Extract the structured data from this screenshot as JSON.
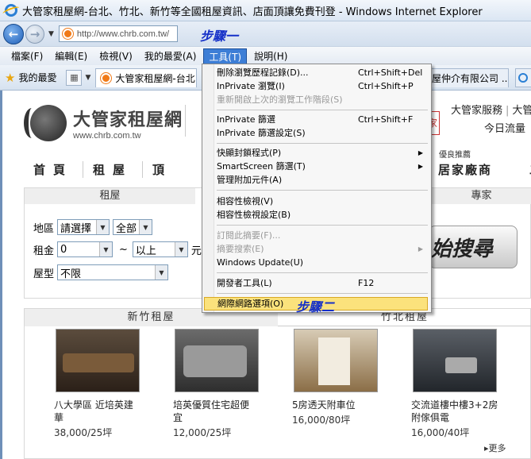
{
  "window": {
    "title": "大管家租屋網-台北、竹北、新竹等全國租屋資訊、店面頂讓免費刊登 - Windows Internet Explorer"
  },
  "address": {
    "url": "http://www.chrb.com.tw/",
    "step1": "步驟一"
  },
  "menubar": {
    "items": [
      "檔案(F)",
      "編輯(E)",
      "檢視(V)",
      "我的最愛(A)",
      "工具(T)",
      "說明(H)"
    ]
  },
  "favbar": {
    "favorites_label": "我的最愛",
    "tab_title": "大管家租屋網-台北...",
    "tab2_title": "屋仲介有限公司 ..."
  },
  "tools_menu": {
    "step2": "步驟二",
    "items": [
      {
        "label": "刪除瀏覽歷程記錄(D)...",
        "shortcut": "Ctrl+Shift+Del"
      },
      {
        "label": "InPrivate 瀏覽(I)",
        "shortcut": "Ctrl+Shift+P"
      },
      {
        "label": "重新開啟上次的瀏覽工作階段(S)",
        "shortcut": ""
      },
      {
        "label": "InPrivate 篩選",
        "shortcut": "Ctrl+Shift+F"
      },
      {
        "label": "InPrivate 篩選設定(S)",
        "shortcut": ""
      },
      {
        "label": "快顯封鎖程式(P)",
        "shortcut": ""
      },
      {
        "label": "SmartScreen 篩選(T)",
        "shortcut": ""
      },
      {
        "label": "管理附加元件(A)",
        "shortcut": ""
      },
      {
        "label": "相容性檢視(V)",
        "shortcut": ""
      },
      {
        "label": "相容性檢視設定(B)",
        "shortcut": ""
      },
      {
        "label": "訂閱此摘要(F)...",
        "shortcut": ""
      },
      {
        "label": "摘要搜索(E)",
        "shortcut": ""
      },
      {
        "label": "Windows Update(U)",
        "shortcut": ""
      },
      {
        "label": "開發者工具(L)",
        "shortcut": "F12"
      },
      {
        "label": "網際網路選項(O)",
        "shortcut": ""
      }
    ]
  },
  "site": {
    "logo_cn": "大管家租屋網",
    "logo_en": "www.chrb.com.tw",
    "top_links": [
      "大管家服務",
      "大管"
    ],
    "today_flow": "今日流量",
    "red_box": "家",
    "badge": "優良推薦",
    "nav": [
      "首頁",
      "租屋",
      "頂",
      "居家廠商",
      "二"
    ],
    "search": {
      "tab_rent": "租屋",
      "tab_expert": "專家",
      "area_label": "地區",
      "area_city": "請選擇",
      "area_district": "全部",
      "rent_label": "租金",
      "rent_min": "0",
      "rent_max": "以上",
      "rent_unit": "元",
      "type_label": "屋型",
      "type_value": "不限",
      "button": "始搜尋"
    },
    "listings": {
      "head_left": "新竹租屋",
      "head_right": "竹北租屋",
      "cards": [
        {
          "title": "八大學區 近培英建華",
          "price": "38,000/25坪"
        },
        {
          "title": "培英優質住宅超便宜",
          "price": "12,000/25坪"
        },
        {
          "title": "5房透天附車位",
          "price": "16,000/80坪"
        },
        {
          "title": "交流道樓中樓3+2房附傢俱電",
          "price": "16,000/40坪"
        }
      ],
      "more": "更多"
    }
  }
}
